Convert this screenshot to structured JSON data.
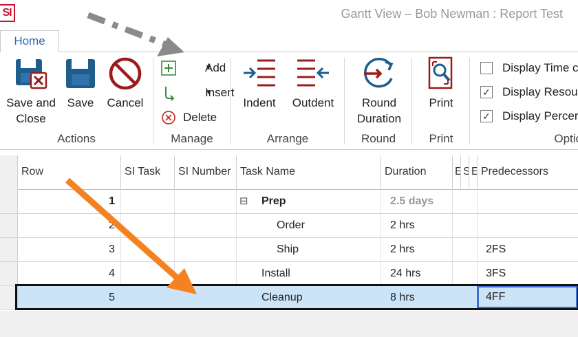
{
  "window": {
    "logo_text": "SI",
    "title": "Gantt View – Bob Newman : Report Test"
  },
  "tabs": [
    {
      "label": "Home",
      "active": true
    }
  ],
  "ribbon": {
    "actions": {
      "label": "Actions",
      "save_close": "Save and\nClose",
      "save": "Save",
      "cancel": "Cancel"
    },
    "manage": {
      "label": "Manage",
      "add": "Add",
      "insert": "Insert",
      "delete": "Delete"
    },
    "arrange": {
      "label": "Arrange",
      "indent": "Indent",
      "outdent": "Outdent"
    },
    "round": {
      "label": "Round",
      "round_duration": "Round\nDuration"
    },
    "print": {
      "label": "Print",
      "print": "Print"
    },
    "options": {
      "label": "Optio",
      "items": [
        {
          "label": "Display Time c",
          "checked": false
        },
        {
          "label": "Display Resou",
          "checked": true
        },
        {
          "label": "Display Percer",
          "checked": true
        }
      ]
    }
  },
  "grid": {
    "columns": [
      "Row",
      "SI Task",
      "SI Number",
      "Task Name",
      "Duration",
      "E",
      "S",
      "E",
      "Predecessors"
    ],
    "rows": [
      {
        "row": "1",
        "task_name": "Prep",
        "duration": "2.5 days",
        "predecessors": "",
        "summary": true,
        "collapse_symbol": "⊟"
      },
      {
        "row": "2",
        "task_name": "Order",
        "duration": "2 hrs",
        "predecessors": ""
      },
      {
        "row": "3",
        "task_name": "Ship",
        "duration": "2 hrs",
        "predecessors": "2FS"
      },
      {
        "row": "4",
        "task_name": "Install",
        "duration": "24 hrs",
        "predecessors": "3FS"
      },
      {
        "row": "5",
        "task_name": "Cleanup",
        "duration": "8 hrs",
        "predecessors": "4FF",
        "selected": true
      }
    ]
  },
  "colors": {
    "accent": "#2b6cb0",
    "icon_dark": "#1f5d8c",
    "icon_red": "#9b1b1b",
    "selection": "#cce4f7",
    "arrow_orange": "#f58220",
    "arrow_gray": "#8a8a8a"
  }
}
